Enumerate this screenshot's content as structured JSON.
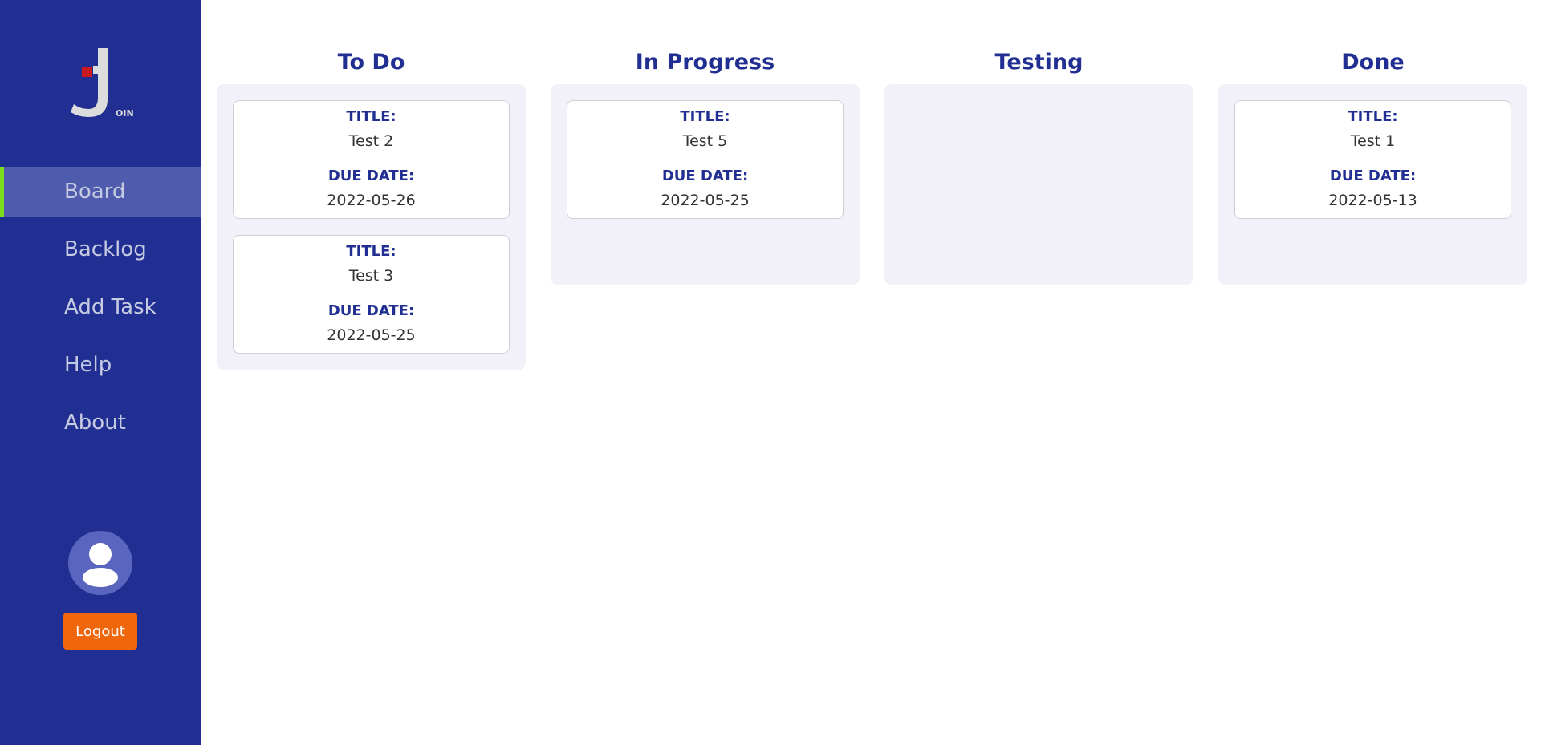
{
  "sidebar": {
    "logo_text": "OIN",
    "nav": [
      {
        "label": "Board",
        "active": true
      },
      {
        "label": "Backlog",
        "active": false
      },
      {
        "label": "Add Task",
        "active": false
      },
      {
        "label": "Help",
        "active": false
      },
      {
        "label": "About",
        "active": false
      }
    ],
    "avatar_icon": "user-avatar-icon",
    "logout_label": "Logout"
  },
  "colors": {
    "sidebar_bg": "#202f91",
    "active_nav_bg": "#4f5bac",
    "active_indicator": "#7cdc1a",
    "logout_bg": "#f0660a",
    "heading": "#202f91",
    "column_bg": "#f2f1fa"
  },
  "board": {
    "columns": [
      {
        "title": "To Do",
        "tasks": [
          {
            "title_label": "TITLE:",
            "title": "Test 2",
            "due_label": "DUE DATE:",
            "due": "2022-05-26"
          },
          {
            "title_label": "TITLE:",
            "title": "Test 3",
            "due_label": "DUE DATE:",
            "due": "2022-05-25"
          }
        ]
      },
      {
        "title": "In Progress",
        "tasks": [
          {
            "title_label": "TITLE:",
            "title": "Test 5",
            "due_label": "DUE DATE:",
            "due": "2022-05-25"
          }
        ]
      },
      {
        "title": "Testing",
        "tasks": []
      },
      {
        "title": "Done",
        "tasks": [
          {
            "title_label": "TITLE:",
            "title": "Test 1",
            "due_label": "DUE DATE:",
            "due": "2022-05-13"
          }
        ]
      }
    ]
  }
}
